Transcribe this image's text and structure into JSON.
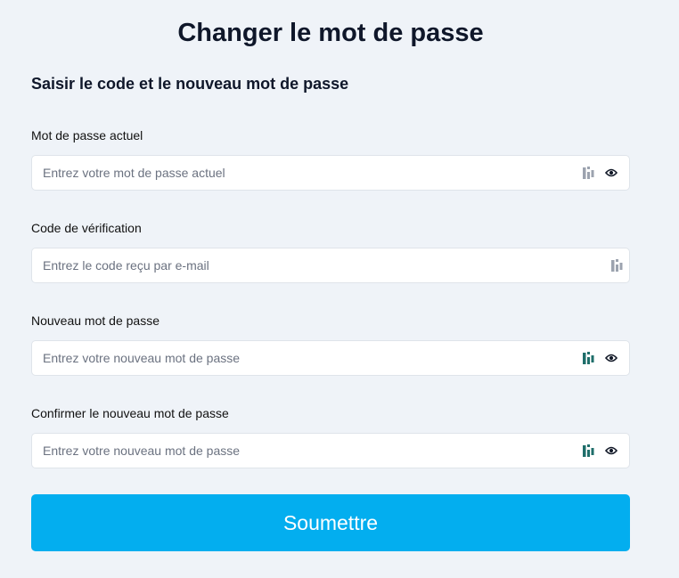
{
  "page": {
    "title": "Changer le mot de passe",
    "subtitle": "Saisir le code et le nouveau mot de passe"
  },
  "fields": [
    {
      "label": "Mot de passe actuel",
      "placeholder": "Entrez votre mot de passe actuel",
      "value": "",
      "icons": [
        "password-manager-icon",
        "eye-icon"
      ]
    },
    {
      "label": "Code de vérification",
      "placeholder": "Entrez le code reçu par e-mail",
      "value": "",
      "icons": [
        "password-manager-icon"
      ]
    },
    {
      "label": "Nouveau mot de passe",
      "placeholder": "Entrez votre nouveau mot de passe",
      "value": "",
      "icons": [
        "password-manager-icon",
        "eye-icon"
      ]
    },
    {
      "label": "Confirmer le nouveau mot de passe",
      "placeholder": "Entrez votre nouveau mot de passe",
      "value": "",
      "icons": [
        "password-manager-icon",
        "eye-icon"
      ]
    }
  ],
  "submit": {
    "label": "Soumettre"
  },
  "colors": {
    "background": "#eff3f8",
    "accent": "#03aeef",
    "password_manager_active": "#1f6e6a",
    "password_manager_inactive": "#9ca3af"
  }
}
